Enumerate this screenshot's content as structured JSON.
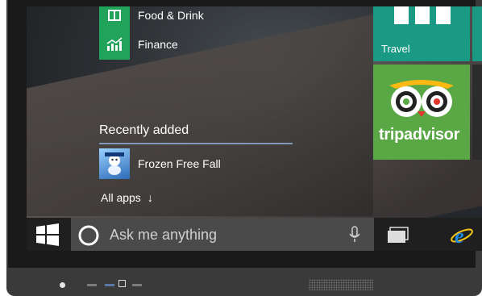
{
  "start_menu": {
    "apps": [
      {
        "label": "Food & Drink",
        "icon": "food-drink-icon"
      },
      {
        "label": "Finance",
        "icon": "finance-chart-icon"
      }
    ],
    "recently_added_title": "Recently added",
    "recent_apps": [
      {
        "label": "Frozen Free Fall",
        "icon": "frozen-free-fall-icon"
      }
    ],
    "all_apps_label": "All apps",
    "all_apps_arrow": "↓"
  },
  "tiles": {
    "travel": {
      "label": "Travel"
    },
    "tripadvisor": {
      "label": "tripadvisor"
    }
  },
  "taskbar": {
    "search_placeholder": "Ask me anything"
  },
  "colors": {
    "tile_green": "#21a35b",
    "travel_teal": "#1a9a84",
    "tripadvisor_green": "#59a845",
    "search_box": "#4a4a4a",
    "accent_line": "#7f9bb8"
  }
}
